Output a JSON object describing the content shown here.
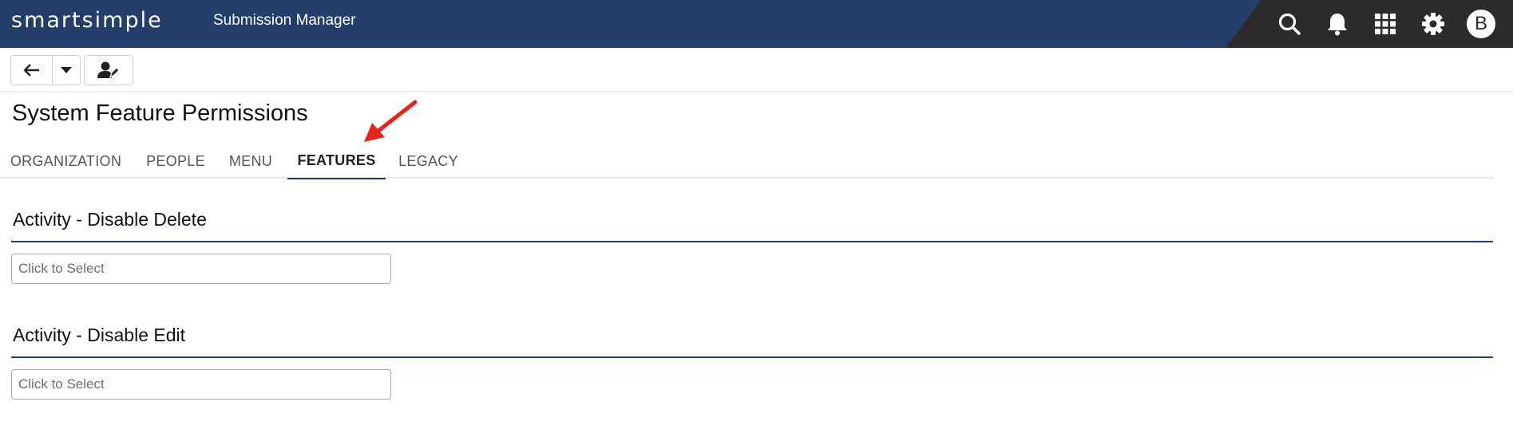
{
  "header": {
    "logo_text": "smartsimple",
    "app_title": "Submission Manager",
    "icons": [
      "search-icon",
      "bell-icon",
      "apps-grid-icon",
      "gear-icon"
    ],
    "avatar_initial": "B",
    "colors": {
      "bar": "#233e6b",
      "bar_dark": "#2b2b2b"
    }
  },
  "toolbar": {
    "buttons": [
      "back-arrow-icon",
      "caret-down-icon",
      "user-edit-icon"
    ]
  },
  "page": {
    "title": "System Feature Permissions"
  },
  "tabs": [
    {
      "label": "ORGANIZATION",
      "active": false
    },
    {
      "label": "PEOPLE",
      "active": false
    },
    {
      "label": "MENU",
      "active": false
    },
    {
      "label": "FEATURES",
      "active": true
    },
    {
      "label": "LEGACY",
      "active": false
    }
  ],
  "sections": [
    {
      "heading": "Activity - Disable Delete",
      "placeholder": "Click to Select"
    },
    {
      "heading": "Activity - Disable Edit",
      "placeholder": "Click to Select"
    }
  ],
  "annotation": {
    "color": "#e8221c",
    "points_to": "FEATURES tab"
  }
}
